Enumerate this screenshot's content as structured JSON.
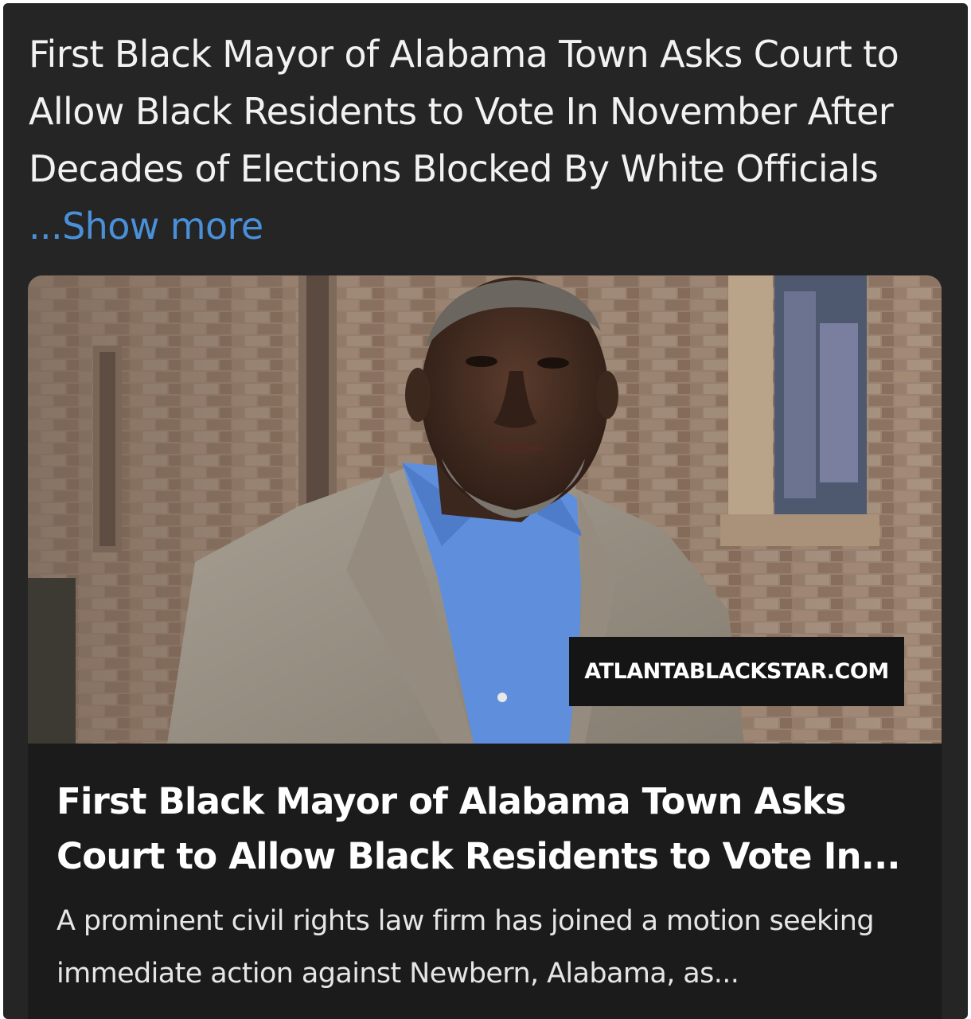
{
  "post": {
    "text": "First Black Mayor of Alabama Town Asks Court to Allow Black Residents to Vote In November After Decades of Elections Blocked By White Officials",
    "show_more_label": "...Show more"
  },
  "link_card": {
    "image_alt": "Photo of a man in a tan plaid blazer and blue shirt standing in front of a brick building",
    "source_label": "ATLANTABLACKSTAR.COM",
    "title": "First Black Mayor of Alabama Town Asks Court to Allow Black Residents to Vote In...",
    "description": "A prominent civil rights law firm has joined a motion seeking immediate action against Newbern, Alabama, as..."
  },
  "colors": {
    "background": "#252525",
    "card_background": "#1b1b1b",
    "link": "#4a90d9",
    "text": "#f2f2f2"
  }
}
